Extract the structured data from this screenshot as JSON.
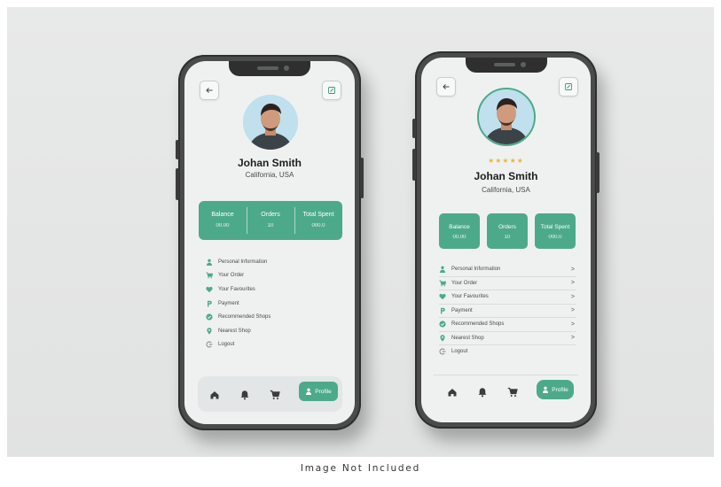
{
  "caption": "Image Not Included",
  "colors": {
    "accent": "#4caa8a",
    "star": "#e8b739",
    "frame": "#4a4b4a",
    "screen": "#eff1f1"
  },
  "profile": {
    "name": "Johan Smith",
    "location": "California, USA",
    "rating_stars": "★★★★★"
  },
  "stats": [
    {
      "label": "Balance",
      "value": "00.00"
    },
    {
      "label": "Orders",
      "value": "10"
    },
    {
      "label": "Total Spent",
      "value": "000.0"
    }
  ],
  "menu": [
    {
      "label": "Personal Information",
      "icon": "person-icon"
    },
    {
      "label": "Your Order",
      "icon": "cart-icon"
    },
    {
      "label": "Your Favourites",
      "icon": "heart-icon"
    },
    {
      "label": "Payment",
      "icon": "payment-icon"
    },
    {
      "label": "Recommended Shops",
      "icon": "shop-icon"
    },
    {
      "label": "Nearest Shop",
      "icon": "location-pin-icon"
    },
    {
      "label": "Logout",
      "icon": "logout-icon"
    }
  ],
  "menu_chevron": ">",
  "nav": {
    "items": [
      "home-icon",
      "bell-icon",
      "cart-icon"
    ],
    "active_label": "Profile"
  },
  "icons": {
    "back": "back-arrow-icon",
    "edit": "edit-icon"
  }
}
